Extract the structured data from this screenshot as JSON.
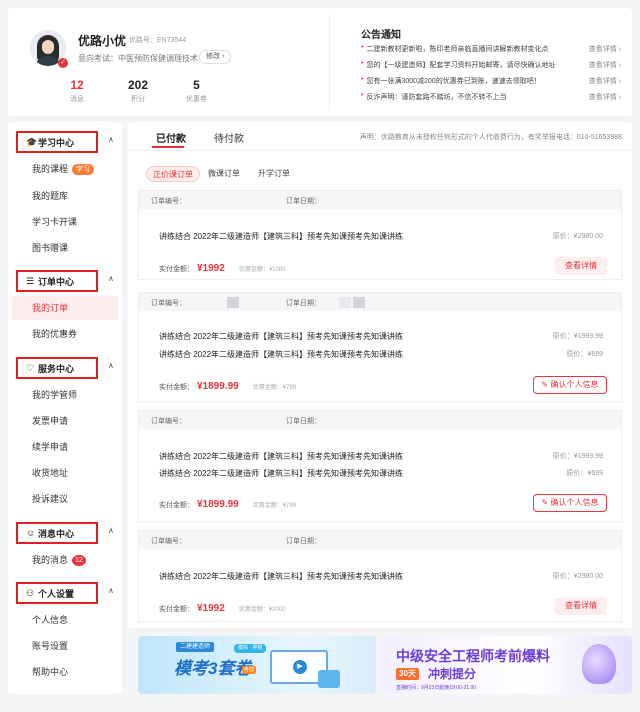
{
  "profile": {
    "name": "优路小优",
    "user_id": "优路号：EN73544",
    "exam_label": "意向考试：中医预防保健调理技术",
    "modify_label": "修改 ›",
    "stats": [
      {
        "num": "12",
        "label": "消息"
      },
      {
        "num": "202",
        "label": "积分"
      },
      {
        "num": "5",
        "label": "优惠券"
      }
    ]
  },
  "notices": {
    "title": "公告通知",
    "more_label": "查看详情 ›",
    "items": [
      "二建新教材更新啦，陈印老师亲临直播间讲解新教材变化点",
      "您的【一级建造师】配套学习资料开始邮寄，请尽快确认地址",
      "您有一张满3000减200的优惠券已到账，速速去领取吧！",
      "反诈声明：谨防套路不踏坊，不信不转不上当"
    ]
  },
  "sidebar": {
    "groups": [
      {
        "icon": "🎓",
        "label": "学习中心",
        "items": [
          {
            "label": "我的课程",
            "tag": "学习"
          },
          {
            "label": "我的题库"
          },
          {
            "label": "学习卡开课"
          },
          {
            "label": "图书赠课"
          }
        ]
      },
      {
        "icon": "☰",
        "label": "订单中心",
        "items": [
          {
            "label": "我的订单"
          },
          {
            "label": "我的优惠券"
          }
        ]
      },
      {
        "icon": "♡",
        "label": "服务中心",
        "items": [
          {
            "label": "我的学管师"
          },
          {
            "label": "发票申请"
          },
          {
            "label": "续学申请"
          },
          {
            "label": "收货地址"
          },
          {
            "label": "投诉建议"
          }
        ]
      },
      {
        "icon": "☺",
        "label": "消息中心",
        "items": [
          {
            "label": "我的消息",
            "tag": "12"
          }
        ]
      },
      {
        "icon": "⚇",
        "label": "个人设置",
        "items": [
          {
            "label": "个人信息"
          },
          {
            "label": "账号设置"
          },
          {
            "label": "帮助中心"
          }
        ]
      }
    ]
  },
  "tabs": [
    "已付款",
    "待付款"
  ],
  "declaration": "声明：优路教育从未授权任何形式的个人代收费行为，有奖举报电话：010-51653988",
  "subtabs": [
    "正价课订单",
    "微课订单",
    "升学订单"
  ],
  "order_labels": {
    "order_no": "订单编号：",
    "order_date": "订单日期：",
    "original_price": "原价：",
    "paid": "实付金额：",
    "discount": "优惠金额：",
    "detail_button": "查看详情",
    "confirm_button": "确认个人信息"
  },
  "orders": [
    {
      "titles": [
        "讲练结合 2022年二级建造师【建筑三科】预考先知课预考先知课讲练"
      ],
      "prices": [
        "原价：¥2980.00"
      ],
      "paid": "¥1992",
      "discount": "优惠金额：¥1000",
      "action": "查看详情"
    },
    {
      "titles": [
        "讲练结合 2022年二级建造师【建筑三科】预考先知课预考先知课讲练",
        "讲练结合 2022年二级建造师【建筑三科】预考先知课预考先知课讲练"
      ],
      "prices": [
        "原价：¥1999.99",
        "原价：¥699"
      ],
      "paid": "¥1899.99",
      "discount": "优惠金额：¥799",
      "action": "确认个人信息"
    },
    {
      "titles": [
        "讲练结合 2022年二级建造师【建筑三科】预考先知课预考先知课讲练",
        "讲练结合 2022年二级建造师【建筑三科】预考先知课预考先知课讲练"
      ],
      "prices": [
        "原价：¥1999.99",
        "原价：¥699"
      ],
      "paid": "¥1899.99",
      "discount": "优惠金额：¥799",
      "action": "确认个人信息"
    },
    {
      "titles": [
        "讲练结合 2022年二级建造师【建筑三科】预考先知课预考先知课讲练"
      ],
      "prices": [
        "原价：¥2980.00"
      ],
      "paid": "¥1992",
      "discount": "优惠金额：¥1000",
      "action": "查看详情"
    }
  ],
  "banners": [
    {
      "tag": "二建建造师",
      "title": "模考3套卷",
      "pill": "模拟 · 押题",
      "badge": "考前"
    },
    {
      "title": "中级安全工程师考前爆料",
      "highlight": "30天",
      "subtitle": "冲刺提分",
      "time": "直播时间：9月23日起晚19:00-21:00"
    }
  ],
  "colors": {
    "accent": "#e8343b",
    "highlight_box": "#e02020"
  }
}
